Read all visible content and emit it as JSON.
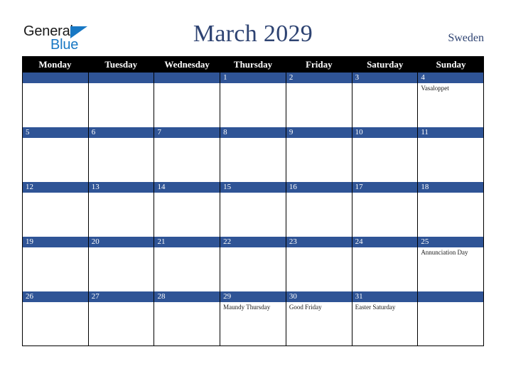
{
  "brand": {
    "word1": "General",
    "word2": "Blue",
    "triangle_icon": "triangle-icon",
    "color_dark": "#1a1a1a",
    "color_blue": "#1878c4"
  },
  "header": {
    "title": "March 2029",
    "country": "Sweden",
    "title_color": "#2e4372"
  },
  "calendar": {
    "header_bg": "#000000",
    "daynum_bg": "#2f5496",
    "weekdays": [
      "Monday",
      "Tuesday",
      "Wednesday",
      "Thursday",
      "Friday",
      "Saturday",
      "Sunday"
    ],
    "weeks": [
      [
        {
          "num": "",
          "events": []
        },
        {
          "num": "",
          "events": []
        },
        {
          "num": "",
          "events": []
        },
        {
          "num": "1",
          "events": []
        },
        {
          "num": "2",
          "events": []
        },
        {
          "num": "3",
          "events": []
        },
        {
          "num": "4",
          "events": [
            "Vasaloppet"
          ]
        }
      ],
      [
        {
          "num": "5",
          "events": []
        },
        {
          "num": "6",
          "events": []
        },
        {
          "num": "7",
          "events": []
        },
        {
          "num": "8",
          "events": []
        },
        {
          "num": "9",
          "events": []
        },
        {
          "num": "10",
          "events": []
        },
        {
          "num": "11",
          "events": []
        }
      ],
      [
        {
          "num": "12",
          "events": []
        },
        {
          "num": "13",
          "events": []
        },
        {
          "num": "14",
          "events": []
        },
        {
          "num": "15",
          "events": []
        },
        {
          "num": "16",
          "events": []
        },
        {
          "num": "17",
          "events": []
        },
        {
          "num": "18",
          "events": []
        }
      ],
      [
        {
          "num": "19",
          "events": []
        },
        {
          "num": "20",
          "events": []
        },
        {
          "num": "21",
          "events": []
        },
        {
          "num": "22",
          "events": []
        },
        {
          "num": "23",
          "events": []
        },
        {
          "num": "24",
          "events": []
        },
        {
          "num": "25",
          "events": [
            "Annunciation Day"
          ]
        }
      ],
      [
        {
          "num": "26",
          "events": []
        },
        {
          "num": "27",
          "events": []
        },
        {
          "num": "28",
          "events": []
        },
        {
          "num": "29",
          "events": [
            "Maundy Thursday"
          ]
        },
        {
          "num": "30",
          "events": [
            "Good Friday"
          ]
        },
        {
          "num": "31",
          "events": [
            "Easter Saturday"
          ]
        },
        {
          "num": "",
          "events": []
        }
      ]
    ]
  }
}
